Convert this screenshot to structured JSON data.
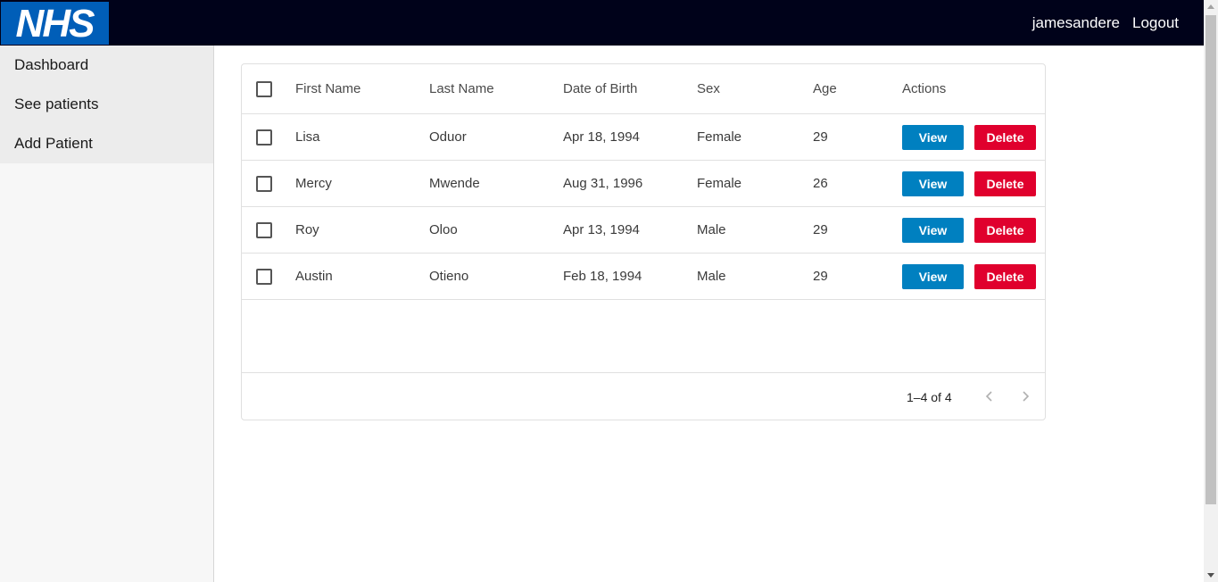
{
  "header": {
    "logo_text": "NHS",
    "username": "jamesandere",
    "logout_label": "Logout",
    "colors": {
      "bar": "#00021a",
      "logo_bg": "#005eb8"
    }
  },
  "sidebar": {
    "items": [
      {
        "label": "Dashboard"
      },
      {
        "label": "See patients"
      },
      {
        "label": "Add Patient"
      }
    ]
  },
  "table": {
    "columns": {
      "first_name": "First Name",
      "last_name": "Last Name",
      "dob": "Date of Birth",
      "sex": "Sex",
      "age": "Age",
      "actions": "Actions"
    },
    "rows": [
      {
        "first_name": "Lisa",
        "last_name": "Oduor",
        "dob": "Apr 18, 1994",
        "sex": "Female",
        "age": "29",
        "view_label": "View",
        "delete_label": "Delete"
      },
      {
        "first_name": "Mercy",
        "last_name": "Mwende",
        "dob": "Aug 31, 1996",
        "sex": "Female",
        "age": "26",
        "view_label": "View",
        "delete_label": "Delete"
      },
      {
        "first_name": "Roy",
        "last_name": "Oloo",
        "dob": "Apr 13, 1994",
        "sex": "Male",
        "age": "29",
        "view_label": "View",
        "delete_label": "Delete"
      },
      {
        "first_name": "Austin",
        "last_name": "Otieno",
        "dob": "Feb 18, 1994",
        "sex": "Male",
        "age": "29",
        "view_label": "View",
        "delete_label": "Delete"
      }
    ],
    "pagination": {
      "range": "1–4 of 4"
    },
    "colors": {
      "view": "#0080c0",
      "delete": "#e0002d"
    }
  }
}
